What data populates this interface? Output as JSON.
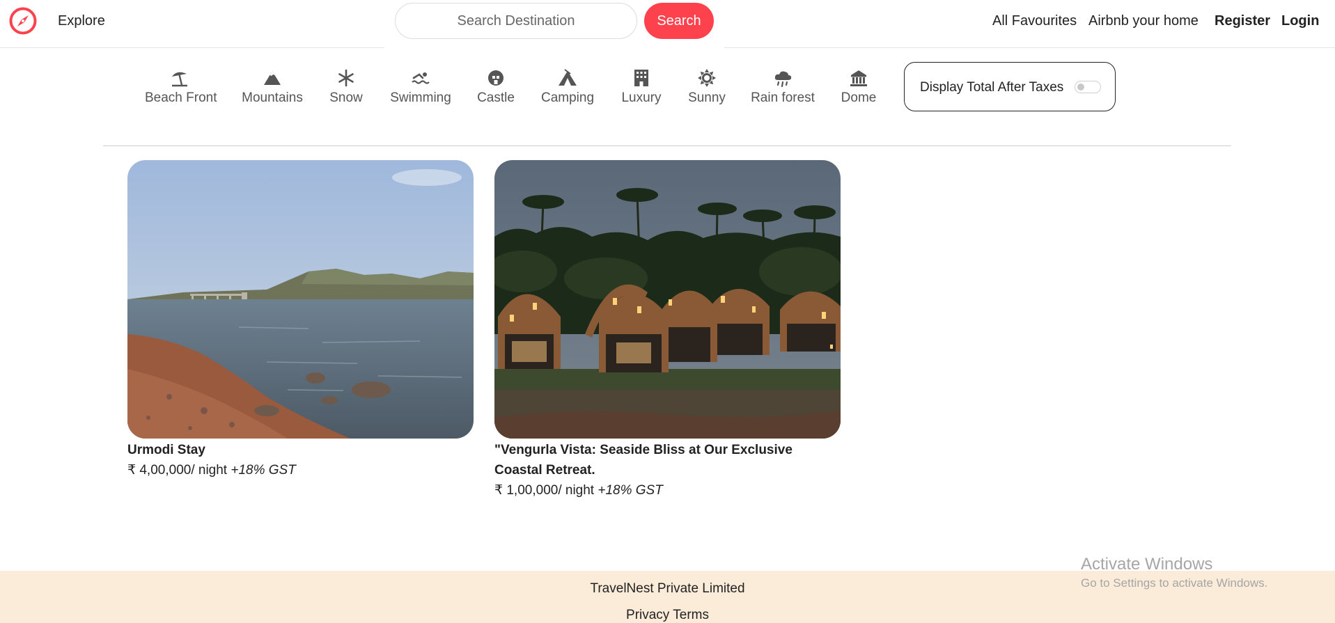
{
  "navbar": {
    "logo_icon": "compass-icon",
    "brand_color": "#fe424d",
    "explore_label": "Explore",
    "search": {
      "placeholder": "Search Destination",
      "value": "",
      "button_label": "Search"
    },
    "links": {
      "favourites": "All Favourites",
      "host": "Airbnb your home",
      "register": "Register",
      "login": "Login"
    }
  },
  "filters": [
    {
      "label": "Beach Front",
      "icon": "umbrella-beach-icon"
    },
    {
      "label": "Mountains",
      "icon": "mountain-icon"
    },
    {
      "label": "Snow",
      "icon": "snowflake-icon"
    },
    {
      "label": "Swimming",
      "icon": "person-swimming-icon"
    },
    {
      "label": "Castle",
      "icon": "fort-icon"
    },
    {
      "label": "Camping",
      "icon": "campground-icon"
    },
    {
      "label": "Luxury",
      "icon": "hotel-building-icon"
    },
    {
      "label": "Sunny",
      "icon": "sun-icon"
    },
    {
      "label": "Rain forest",
      "icon": "cloud-rain-icon"
    },
    {
      "label": "Dome",
      "icon": "dome-building-icon"
    }
  ],
  "tax_toggle": {
    "label": "Display Total After Taxes",
    "enabled": false
  },
  "listings": [
    {
      "title": "Urmodi Stay",
      "price": "₹ 4,00,000/ night ",
      "tax_note": "+18% GST",
      "image": "lake-shore-photo"
    },
    {
      "title": "\"Vengurla Vista: Seaside Bliss at Our Exclusive Coastal Retreat.",
      "price": "₹ 1,00,000/ night ",
      "tax_note": "+18% GST",
      "image": "beach-cottages-night-photo"
    }
  ],
  "footer": {
    "company": "TravelNest Private Limited",
    "privacy": "Privacy",
    "terms": "Terms",
    "background": "#fbebd9"
  },
  "watermark": {
    "title": "Activate Windows",
    "subtitle": "Go to Settings to activate Windows."
  }
}
